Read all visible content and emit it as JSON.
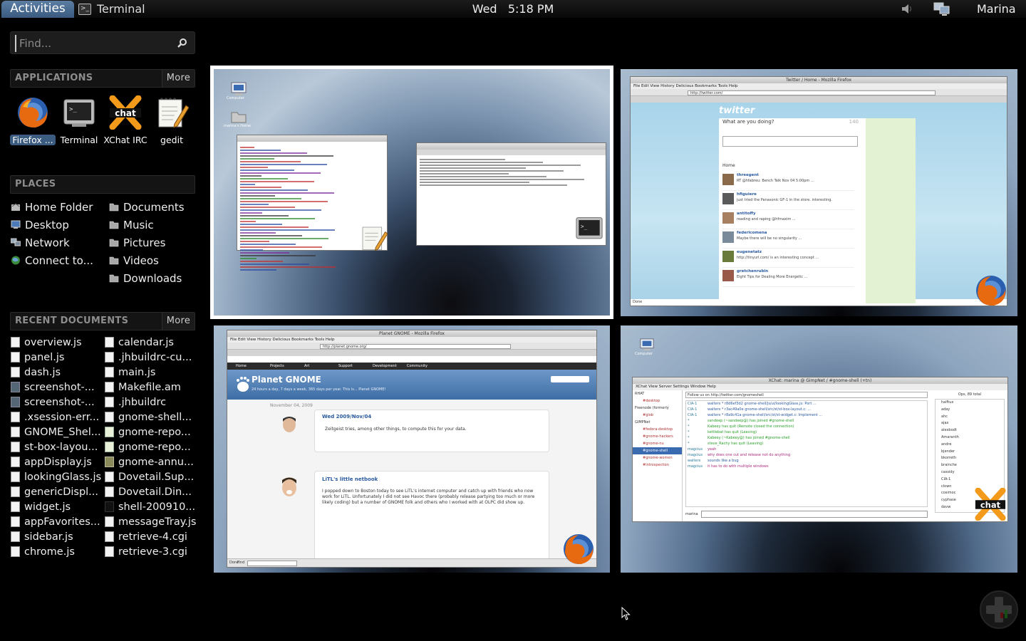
{
  "top_panel": {
    "activities": "Activities",
    "app_name": "Terminal",
    "clock_day": "Wed",
    "clock_time": "5:18 PM",
    "user": "Marina"
  },
  "search": {
    "placeholder": "Find..."
  },
  "applications": {
    "header": "APPLICATIONS",
    "more": "More",
    "items": [
      {
        "label": "Firefox ...",
        "icon": "firefox-icon"
      },
      {
        "label": "Terminal",
        "icon": "terminal-icon"
      },
      {
        "label": "XChat IRC",
        "icon": "xchat-icon"
      },
      {
        "label": "gedit",
        "icon": "gedit-icon"
      }
    ]
  },
  "places": {
    "header": "PLACES",
    "left": [
      {
        "label": "Home Folder",
        "icon": "home-folder-icon"
      },
      {
        "label": "Desktop",
        "icon": "desktop-icon"
      },
      {
        "label": "Network",
        "icon": "network-icon"
      },
      {
        "label": "Connect to...",
        "icon": "connect-server-icon"
      }
    ],
    "right": [
      {
        "label": "Documents",
        "icon": "folder-icon"
      },
      {
        "label": "Music",
        "icon": "folder-icon"
      },
      {
        "label": "Pictures",
        "icon": "folder-icon"
      },
      {
        "label": "Videos",
        "icon": "folder-icon"
      },
      {
        "label": "Downloads",
        "icon": "folder-icon"
      }
    ]
  },
  "recent": {
    "header": "RECENT DOCUMENTS",
    "more": "More",
    "left": [
      "overview.js",
      "panel.js",
      "dash.js",
      "screenshot-...",
      "screenshot-...",
      ".xsession-err...",
      "GNOME_Shel...",
      "st-box-layou...",
      "appDisplay.js",
      "lookingGlass.js",
      "genericDispl...",
      "widget.js",
      "appFavorites...",
      "sidebar.js",
      "chrome.js"
    ],
    "right": [
      "calendar.js",
      ".jhbuildrc-cu...",
      "main.js",
      "Makefile.am",
      ".jhbuildrc",
      "gnome-shell...",
      "gnome-repo...",
      "gnome-repo...",
      "gnome-annu...",
      "Dovetail.Sup...",
      "Dovetail.Din...",
      "shell-200910...",
      "messageTray.js",
      "retrieve-4.cgi",
      "retrieve-3.cgi"
    ]
  },
  "windows": {
    "workspace": {
      "desktop_icons": [
        "Computer",
        "marina's Home"
      ]
    },
    "twitter": {
      "title": "Twitter / Home - Mozilla Firefox",
      "menu": "File  Edit  View  History  Delicious  Bookmarks  Tools  Help",
      "url": "http://twitter.com/",
      "logo": "twitter",
      "question": "What are you doing?",
      "count": "140",
      "home": "Home",
      "tweets": [
        {
          "user": "threegent",
          "text": "RT @hfabreu: Bench Talk Nov 04 5:00pm ...",
          "color": "#8a6a4a"
        },
        {
          "user": "hfiguiere",
          "text": "just tried the Panasonic GF-1 in the store. interesting.",
          "color": "#5a5a5a"
        },
        {
          "user": "antitoffy",
          "text": "reading and raping @hfmaxim ...",
          "color": "#a68060"
        },
        {
          "user": "federicomena",
          "text": "Maybe there will be no singularity ...",
          "color": "#7a8a9a"
        },
        {
          "user": "eugenetatz",
          "text": "http://tinyurl.com/ is an interesting concept ...",
          "color": "#6a7a3a"
        },
        {
          "user": "gretchenrubin",
          "text": "Eight Tips for Dealing More Energetic ...",
          "color": "#9a5a4a"
        }
      ],
      "status": "Done"
    },
    "planet": {
      "title": "Planet GNOME - Mozilla Firefox",
      "menu": "File  Edit  View  History  Delicious  Bookmarks  Tools  Help",
      "url": "http://planet.gnome.org/",
      "heading": "Planet GNOME",
      "tagline": "24 hours a day, 7 days a week, 365 days per year. This is... Planet GNOME!",
      "nav": [
        "Home",
        "Projects",
        "Art",
        "Support",
        "Development",
        "Community"
      ],
      "date": "November 04, 2009",
      "post1_title": "Wed 2009/Nov/04",
      "post1_text": "Zeitgeist tries, among other things, to compute this for your data.",
      "post2_title": "LiTL's little netbook",
      "post2_text": "I popped down to Boston today to see LiTL's internet computer and catch up with friends who now work for LiTL. Unfortunately I did not see Havoc there (probably release partying too much or more likely coding) but a number of GNOME folk and others who I worked with at OLPC did show up.",
      "status": "Done",
      "find": "Find"
    },
    "xchat": {
      "title": "XChat: marina @ GimpNet / #gnome-shell (+tn)",
      "menu": "XChat  View  Server  Settings  Window  Help",
      "topic": "Follow us on http://twitter.com/gnomeshell",
      "channels": [
        "RHAT",
        "#desktop",
        "Freenode (formerly",
        "#glob",
        "GIMPNet",
        "#fedora-desktop",
        "#gnome-hackers",
        "#gnome-nu",
        "#gnome-shell",
        "#gnome-women",
        "#introspection"
      ],
      "users_header": "Ops, 89 total",
      "users": [
        "halftux",
        "aday",
        "ahc",
        "ajax",
        "alexbodt",
        "Amaranth",
        "andre",
        "bjender",
        "bkorreth",
        "brainche",
        "cassidy",
        "CIA-1",
        "clown",
        "cosimoc",
        "cyphase",
        "davw"
      ],
      "nick": "marina",
      "log": [
        {
          "n": "CIA-1",
          "t": "walters * r8d6ef3d2 gnome-shell/js/ui/lookingGlass.js: Port ...",
          "c": "#2a5aa0"
        },
        {
          "n": "CIA-1",
          "t": "walters * r3ac49a0e gnome-shell/src/st/st-box-layout.c: ...",
          "c": "#2a5aa0"
        },
        {
          "n": "CIA-1",
          "t": "walters * r8a9c41a gnome-shell/src/st/st-widget.c: Implement ...",
          "c": "#2a5aa0"
        },
        {
          "n": "*",
          "t": "sandeep (~sandeep@) has joined #gnome-shell",
          "c": "#2aa02a"
        },
        {
          "n": "*",
          "t": "Kabeey has quit (Remote closed the connection)",
          "c": "#2aa02a"
        },
        {
          "n": "*",
          "t": "kettlebat has quit (Leaving)",
          "c": "#2aa02a"
        },
        {
          "n": "*",
          "t": "Kabeey (~Kabeey@) has joined #gnome-shell",
          "c": "#2aa02a"
        },
        {
          "n": "*",
          "t": "steve_Rachy has quit (Leaving)",
          "c": "#2aa02a"
        },
        {
          "n": "magcius",
          "t": "yeah",
          "c": "#aa2a7a"
        },
        {
          "n": "magcius",
          "t": "why does one cut and release not do anything",
          "c": "#aa2a7a"
        },
        {
          "n": "walters",
          "t": "sounds like a bug",
          "c": "#2a5aa0"
        },
        {
          "n": "magcius",
          "t": "it has to do with multiple windows",
          "c": "#aa2a7a"
        }
      ]
    }
  }
}
